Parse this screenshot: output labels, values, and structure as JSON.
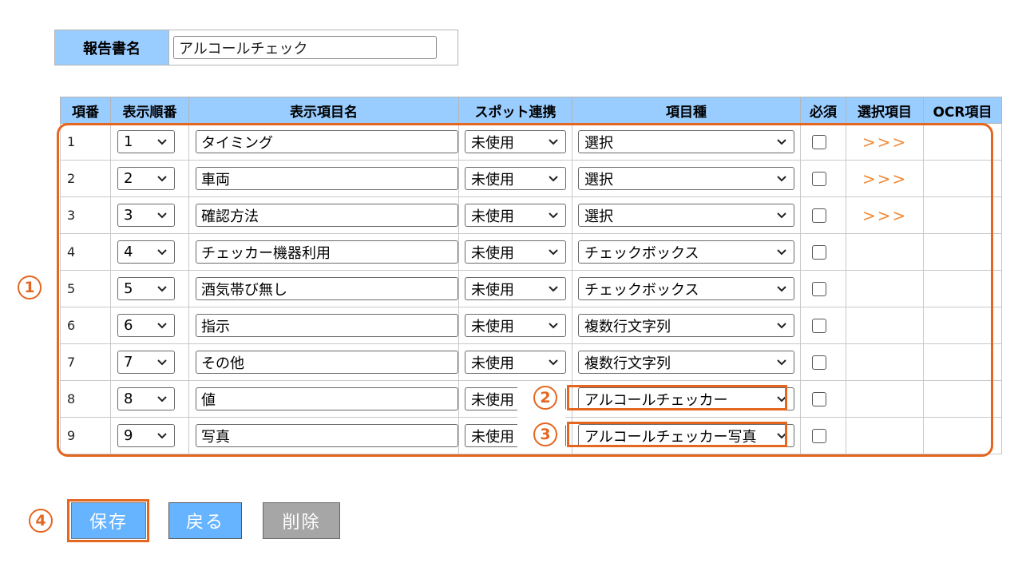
{
  "report": {
    "label": "報告書名",
    "value": "アルコールチェック"
  },
  "table": {
    "headers": [
      "項番",
      "表示順番",
      "表示項目名",
      "スポット連携",
      "項目種",
      "必須",
      "選択項目",
      "OCR項目"
    ],
    "rows": [
      {
        "no": "1",
        "order": "1",
        "name": "タイミング",
        "spot": "未使用",
        "type": "選択",
        "required": false,
        "select": ">>>"
      },
      {
        "no": "2",
        "order": "2",
        "name": "車両",
        "spot": "未使用",
        "type": "選択",
        "required": false,
        "select": ">>>"
      },
      {
        "no": "3",
        "order": "3",
        "name": "確認方法",
        "spot": "未使用",
        "type": "選択",
        "required": false,
        "select": ">>>"
      },
      {
        "no": "4",
        "order": "4",
        "name": "チェッカー機器利用",
        "spot": "未使用",
        "type": "チェックボックス",
        "required": false,
        "select": ""
      },
      {
        "no": "5",
        "order": "5",
        "name": "酒気帯び無し",
        "spot": "未使用",
        "type": "チェックボックス",
        "required": false,
        "select": ""
      },
      {
        "no": "6",
        "order": "6",
        "name": "指示",
        "spot": "未使用",
        "type": "複数行文字列",
        "required": false,
        "select": ""
      },
      {
        "no": "7",
        "order": "7",
        "name": "その他",
        "spot": "未使用",
        "type": "複数行文字列",
        "required": false,
        "select": ""
      },
      {
        "no": "8",
        "order": "8",
        "name": "値",
        "spot": "未使用",
        "type": "アルコールチェッカー",
        "required": false,
        "select": ""
      },
      {
        "no": "9",
        "order": "9",
        "name": "写真",
        "spot": "未使用",
        "type": "アルコールチェッカー写真",
        "required": false,
        "select": ""
      }
    ]
  },
  "buttons": {
    "save": "保存",
    "back": "戻る",
    "delete": "削除"
  },
  "markers": {
    "m1": "1",
    "m2": "2",
    "m3": "3",
    "m4": "4"
  },
  "colors": {
    "header_bg": "#99ccff",
    "highlight": "#e5661f",
    "button_blue": "#66b3ff",
    "button_gray": "#a6a6a6",
    "link_orange": "#f08a38"
  }
}
